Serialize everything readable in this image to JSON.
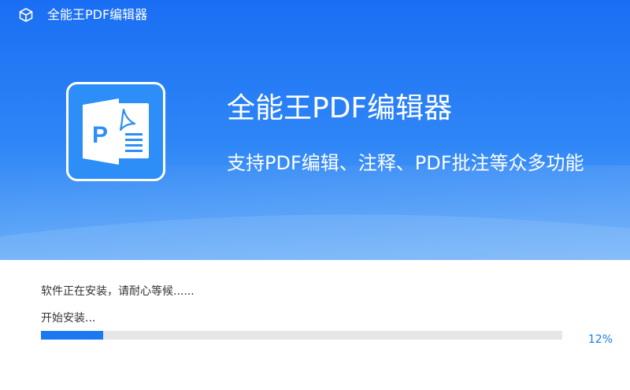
{
  "window": {
    "title": "全能王PDF编辑器",
    "icon": "cube-icon"
  },
  "hero": {
    "logo_icon": "pdf-document-icon",
    "title": "全能王PDF编辑器",
    "subtitle": "支持PDF编辑、注释、PDF批注等众多功能"
  },
  "install": {
    "status": "软件正在安装，请耐心等候......",
    "step": "开始安装...",
    "progress_percent": 12,
    "progress_label": "12%"
  },
  "colors": {
    "accent": "#1a78f0",
    "hero_top": "#1a6ef4",
    "hero_bottom": "#5fa8f8",
    "track": "#e6e6e6"
  }
}
